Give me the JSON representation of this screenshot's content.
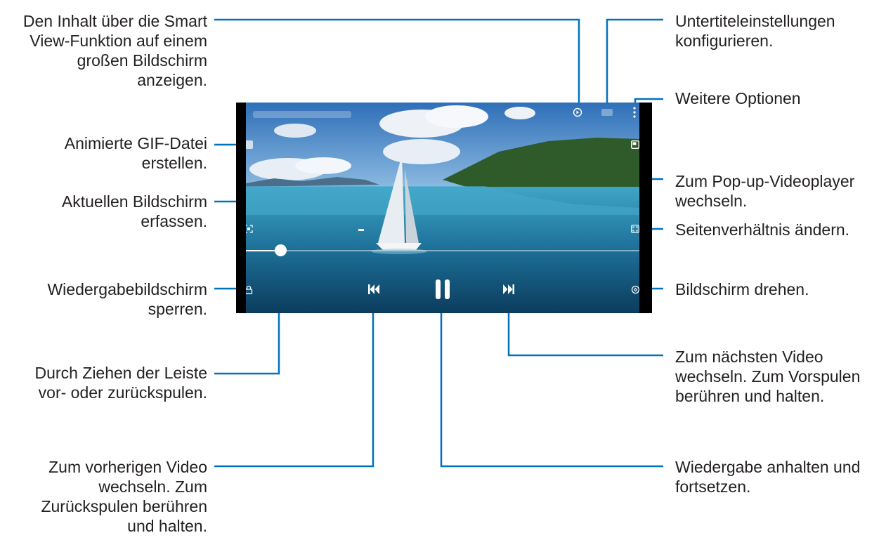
{
  "labels": {
    "smart_view": "Den Inhalt über die Smart\nView-Funktion auf einem\ngroßen Bildschirm\nanzeigen.",
    "gif": "Animierte GIF-Datei\nerstellen.",
    "capture": "Aktuellen Bildschirm\nerfassen.",
    "lock": "Wiedergabebildschirm\nsperren.",
    "seek": "Durch Ziehen der Leiste\nvor- oder zurückspulen.",
    "previous": "Zum vorherigen Video\nwechseln. Zum\nZurückspulen berühren\nund halten.",
    "subtitles": "Untertiteleinstellungen\nkonfigurieren.",
    "more": "Weitere Optionen",
    "popup": "Zum Pop-up-Videoplayer\nwechseln.",
    "ratio": "Seitenverhältnis ändern.",
    "rotate": "Bildschirm drehen.",
    "next": "Zum nächsten Video\nwechseln. Zum Vorspulen\nberühren und halten.",
    "pause": "Wiedergabe anhalten und\nfortsetzen."
  },
  "player": {
    "progress": 0.09,
    "icons": [
      "smart-view-icon",
      "subtitle-icon",
      "more-options-icon",
      "gif-icon",
      "popup-player-icon",
      "capture-icon",
      "aspect-ratio-icon",
      "lock-icon",
      "rotate-icon",
      "previous-icon",
      "pause-icon",
      "next-icon"
    ]
  },
  "colors": {
    "leader": "#0072bc",
    "text": "#231f20"
  }
}
